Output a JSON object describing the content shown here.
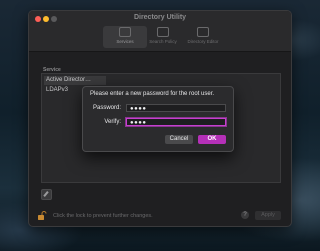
{
  "window": {
    "title": "Directory Utility"
  },
  "toolbar": {
    "items": [
      {
        "label": "Services",
        "selected": true
      },
      {
        "label": "Search Policy",
        "selected": false
      },
      {
        "label": "Directory Editor",
        "selected": false
      }
    ]
  },
  "services": {
    "header": "Service",
    "rows": [
      "Active Director…",
      "LDAPv3"
    ]
  },
  "footer": {
    "lock_text": "Click the lock to prevent further changes.",
    "help_label": "?",
    "apply_label": "Apply"
  },
  "sheet": {
    "prompt": "Please enter a new password for the root user.",
    "password_label": "Password:",
    "password_value": "●●●●",
    "verify_label": "Verify:",
    "verify_value": "●●●●",
    "cancel_label": "Cancel",
    "ok_label": "OK"
  },
  "colors": {
    "accent": "#b530b8",
    "focus_ring": "#c63fcf"
  }
}
